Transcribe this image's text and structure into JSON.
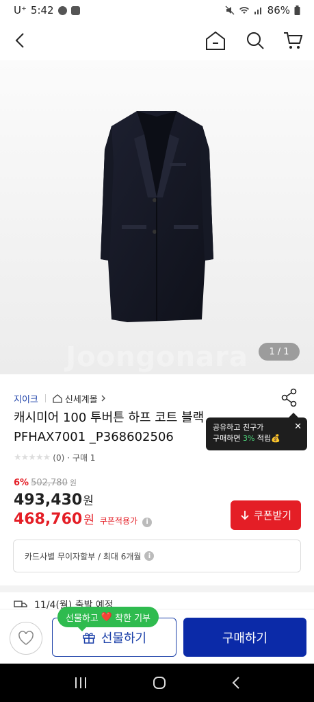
{
  "status_bar": {
    "time": "5:42",
    "carrier": "U⁺",
    "battery": "86%"
  },
  "product": {
    "image_counter_current": "1",
    "image_counter_sep": "/",
    "image_counter_total": "1",
    "watermark": "Joongonara",
    "brand": "지이크",
    "store": "신세계몰",
    "title_line1": "캐시미어 100 투버튼 하프 코트 블랙",
    "title_line2": "PFHAX7001 _P368602506",
    "rating_stars": "★★★★★",
    "review_count": "(0)",
    "purchase_count": "· 구매 1",
    "discount_rate": "6%",
    "original_price": "502,780",
    "original_price_unit": "원",
    "price": "493,430",
    "price_unit": "원",
    "coupon_price": "468,760",
    "coupon_price_unit": "원",
    "coupon_applied_label": "쿠폰적용가",
    "coupon_button": "쿠폰받기",
    "installment_info": "카드사별 무이자할부 / 최대 6개월",
    "delivery_info": "11/4(월) 출발 예정"
  },
  "share_tooltip": {
    "line1": "공유하고 친구가",
    "line2_prefix": "구매하면 ",
    "line2_highlight": "3%",
    "line2_suffix": " 적립💰",
    "close": "✕"
  },
  "bottom_bar": {
    "gift_badge_prefix": "선물하고",
    "gift_badge_heart": "❤️",
    "gift_badge_suffix": "착한 기부",
    "gift_button": "선물하기",
    "buy_button": "구매하기"
  },
  "colors": {
    "brand_blue": "#1a3fa8",
    "buy_blue": "#0b2aa8",
    "sale_red": "#e41e26",
    "gift_green": "#2fbb4f"
  }
}
